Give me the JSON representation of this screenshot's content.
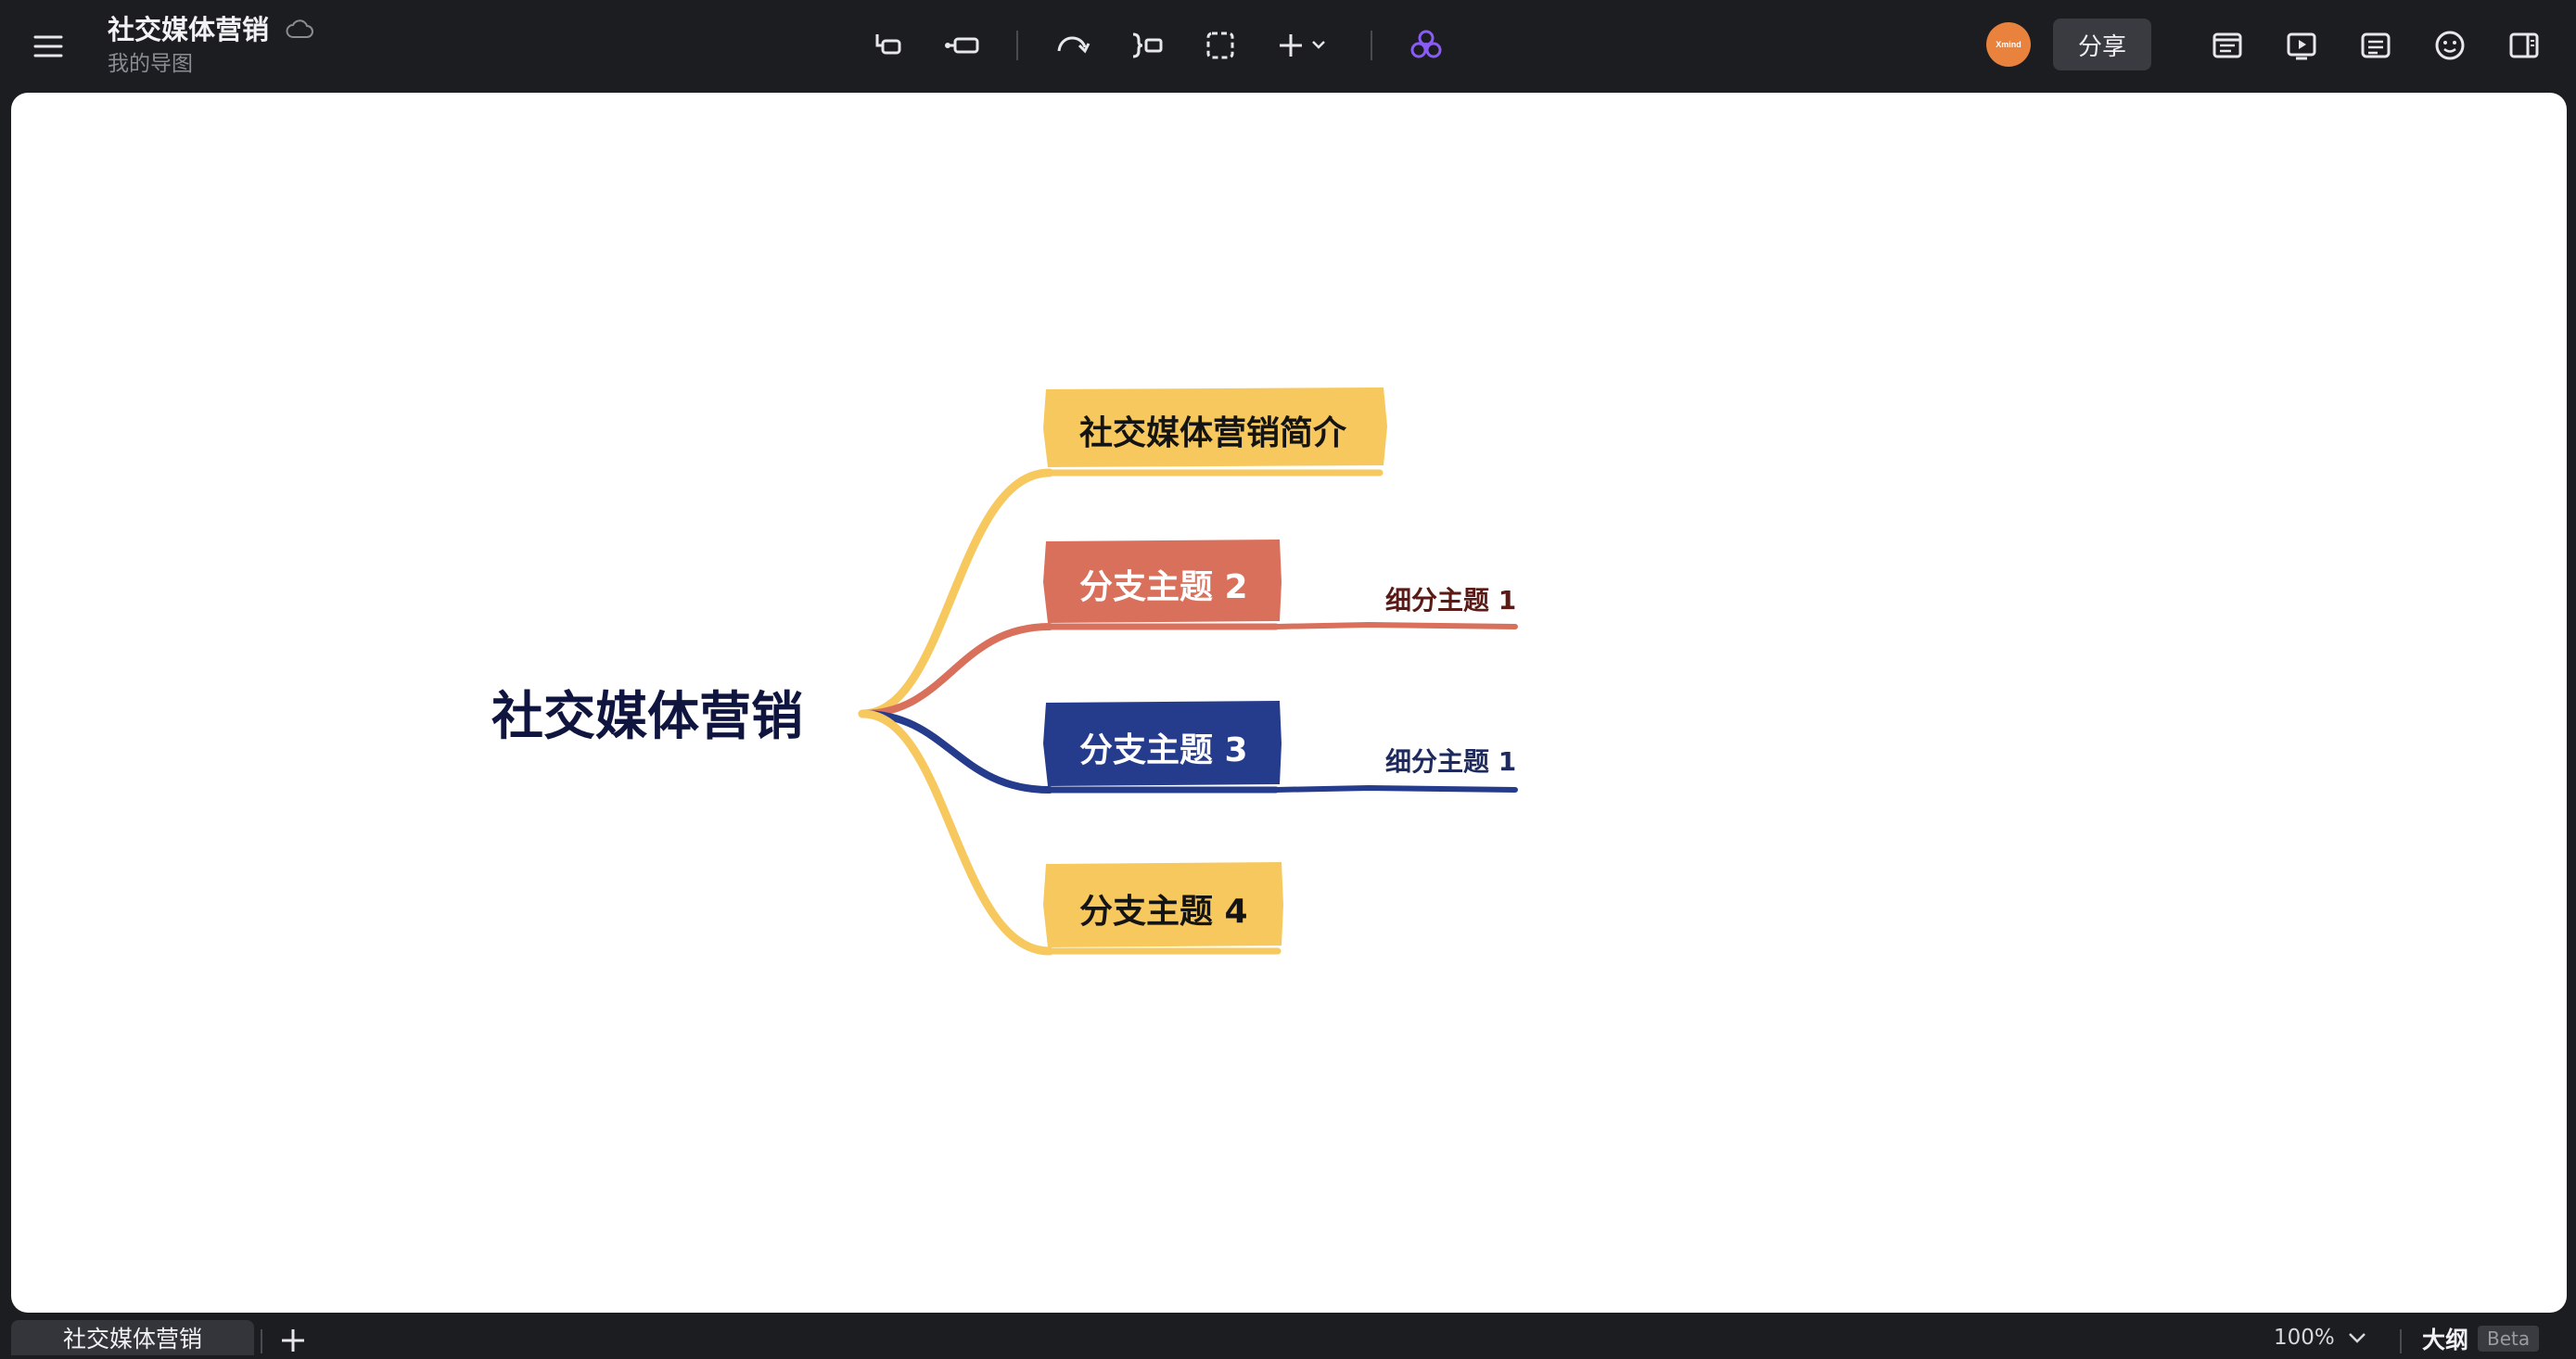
{
  "header": {
    "title": "社交媒体营销",
    "subtitle": "我的导图",
    "avatar_text": "Xmind",
    "share_label": "分享"
  },
  "toolbar": {
    "center_icons": [
      "subtopic-icon",
      "topic-icon",
      "relationship-icon",
      "summary-icon",
      "boundary-icon",
      "insert-icon",
      "ai-icon"
    ],
    "right_icons": [
      "format-icon",
      "pitch-icon",
      "notes-icon",
      "emoji-icon",
      "sidebar-icon"
    ]
  },
  "mindmap": {
    "central": "社交媒体营销",
    "branches": [
      {
        "label": "社交媒体营销简介",
        "color": "#f6c85e",
        "subtopics": []
      },
      {
        "label": "分支主题 2",
        "color": "#d8705b",
        "subtopics": [
          "细分主题 1"
        ]
      },
      {
        "label": "分支主题 3",
        "color": "#253b8c",
        "subtopics": [
          "细分主题 1"
        ]
      },
      {
        "label": "分支主题 4",
        "color": "#f6c85e",
        "subtopics": []
      }
    ]
  },
  "bottombar": {
    "sheet_tab": "社交媒体营销",
    "zoom": "100%",
    "outline_label": "大纲",
    "beta_label": "Beta"
  },
  "colors": {
    "background": "#1c1d21",
    "canvas": "#ffffff",
    "accent_purple": "#8a5cf5"
  }
}
